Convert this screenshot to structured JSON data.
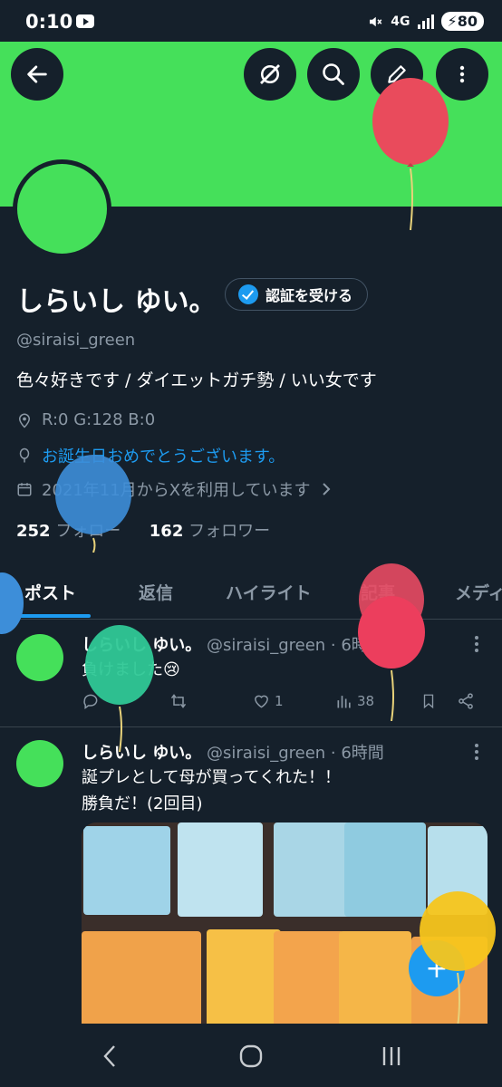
{
  "status_bar": {
    "time": "0:10",
    "network": "4G",
    "battery": "80"
  },
  "profile": {
    "display_name": "しらいし ゆい。",
    "verify_button": "認証を受ける",
    "handle": "@siraisi_green",
    "bio": "色々好きです / ダイエットガチ勢 / いい女です",
    "location": "R:0 G:128 B:0",
    "birthday": "お誕生日おめでとうございます。",
    "joined": "2021年11月からXを利用しています",
    "following_count": "252",
    "following_label": "フォロー",
    "followers_count": "162",
    "followers_label": "フォロワー"
  },
  "tabs": [
    {
      "label": "ポスト"
    },
    {
      "label": "返信"
    },
    {
      "label": "ハイライト"
    },
    {
      "label": "記事"
    },
    {
      "label": "メディア"
    }
  ],
  "posts": [
    {
      "name": "しらいし ゆい。",
      "handle_time": "@siraisi_green · 6時間",
      "text": "負けました😢",
      "likes": "1",
      "views": "38"
    },
    {
      "name": "しらいし ゆい。",
      "handle_time": "@siraisi_green · 6時間",
      "text_line1": "誕プレとして母が買ってくれた！！",
      "text_line2": "勝負だ！(2回目)"
    }
  ],
  "fab": {
    "label": "+"
  },
  "colors": {
    "banner": "#45e05a",
    "background": "#15202b",
    "accent": "#1d9bf0"
  }
}
